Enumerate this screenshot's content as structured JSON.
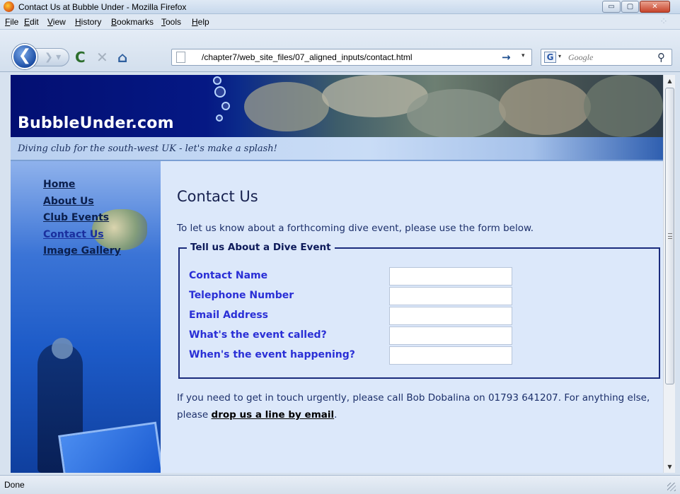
{
  "window": {
    "title": "Contact Us at Bubble Under - Mozilla Firefox",
    "minimize_glyph": "▭",
    "maximize_glyph": "▢",
    "close_glyph": "✕"
  },
  "menubar": {
    "items": [
      "File",
      "Edit",
      "View",
      "History",
      "Bookmarks",
      "Tools",
      "Help"
    ]
  },
  "navbar": {
    "back_glyph": "❮",
    "forward_glyph": "❯ ▾",
    "reload_glyph": "C",
    "stop_glyph": "✕",
    "home_glyph": "⌂",
    "url": "/chapter7/web_site_files/07_aligned_inputs/contact.html",
    "go_glyph": "→",
    "url_dropdown_glyph": "▾",
    "search_engine_glyph": "G",
    "search_dropdown_glyph": "▾",
    "search_placeholder": "Google",
    "search_glyph": "⚲"
  },
  "site": {
    "title": "BubbleUnder.com",
    "tagline": "Diving club for the south-west UK - let's make a splash!",
    "nav": [
      {
        "label": "Home",
        "current": false
      },
      {
        "label": "About Us",
        "current": false
      },
      {
        "label": "Club Events",
        "current": false
      },
      {
        "label": "Contact Us",
        "current": true
      },
      {
        "label": "Image Gallery",
        "current": false
      }
    ]
  },
  "content": {
    "heading": "Contact Us",
    "intro": "To let us know about a forthcoming dive event, please use the form below.",
    "fieldset_legend": "Tell us About a Dive Event",
    "fields": [
      {
        "label": "Contact Name",
        "value": ""
      },
      {
        "label": "Telephone Number",
        "value": ""
      },
      {
        "label": "Email Address",
        "value": ""
      },
      {
        "label": "What's the event called?",
        "value": ""
      },
      {
        "label": "When's the event happening?",
        "value": ""
      }
    ],
    "footer_before": "If you need to get in touch urgently, please call Bob Dobalina on 01793 641207. For anything else, please ",
    "footer_link": "drop us a line by email",
    "footer_after": "."
  },
  "scrollbar": {
    "up_glyph": "▲",
    "down_glyph": "▼"
  },
  "statusbar": {
    "text": "Done"
  },
  "colors": {
    "banner_dark": "#030f72",
    "sidebar_blue": "#1d5bc8",
    "content_bg": "#dce8fa",
    "label_blue": "#2a2fd6",
    "fieldset_border": "#1a2b7c"
  }
}
